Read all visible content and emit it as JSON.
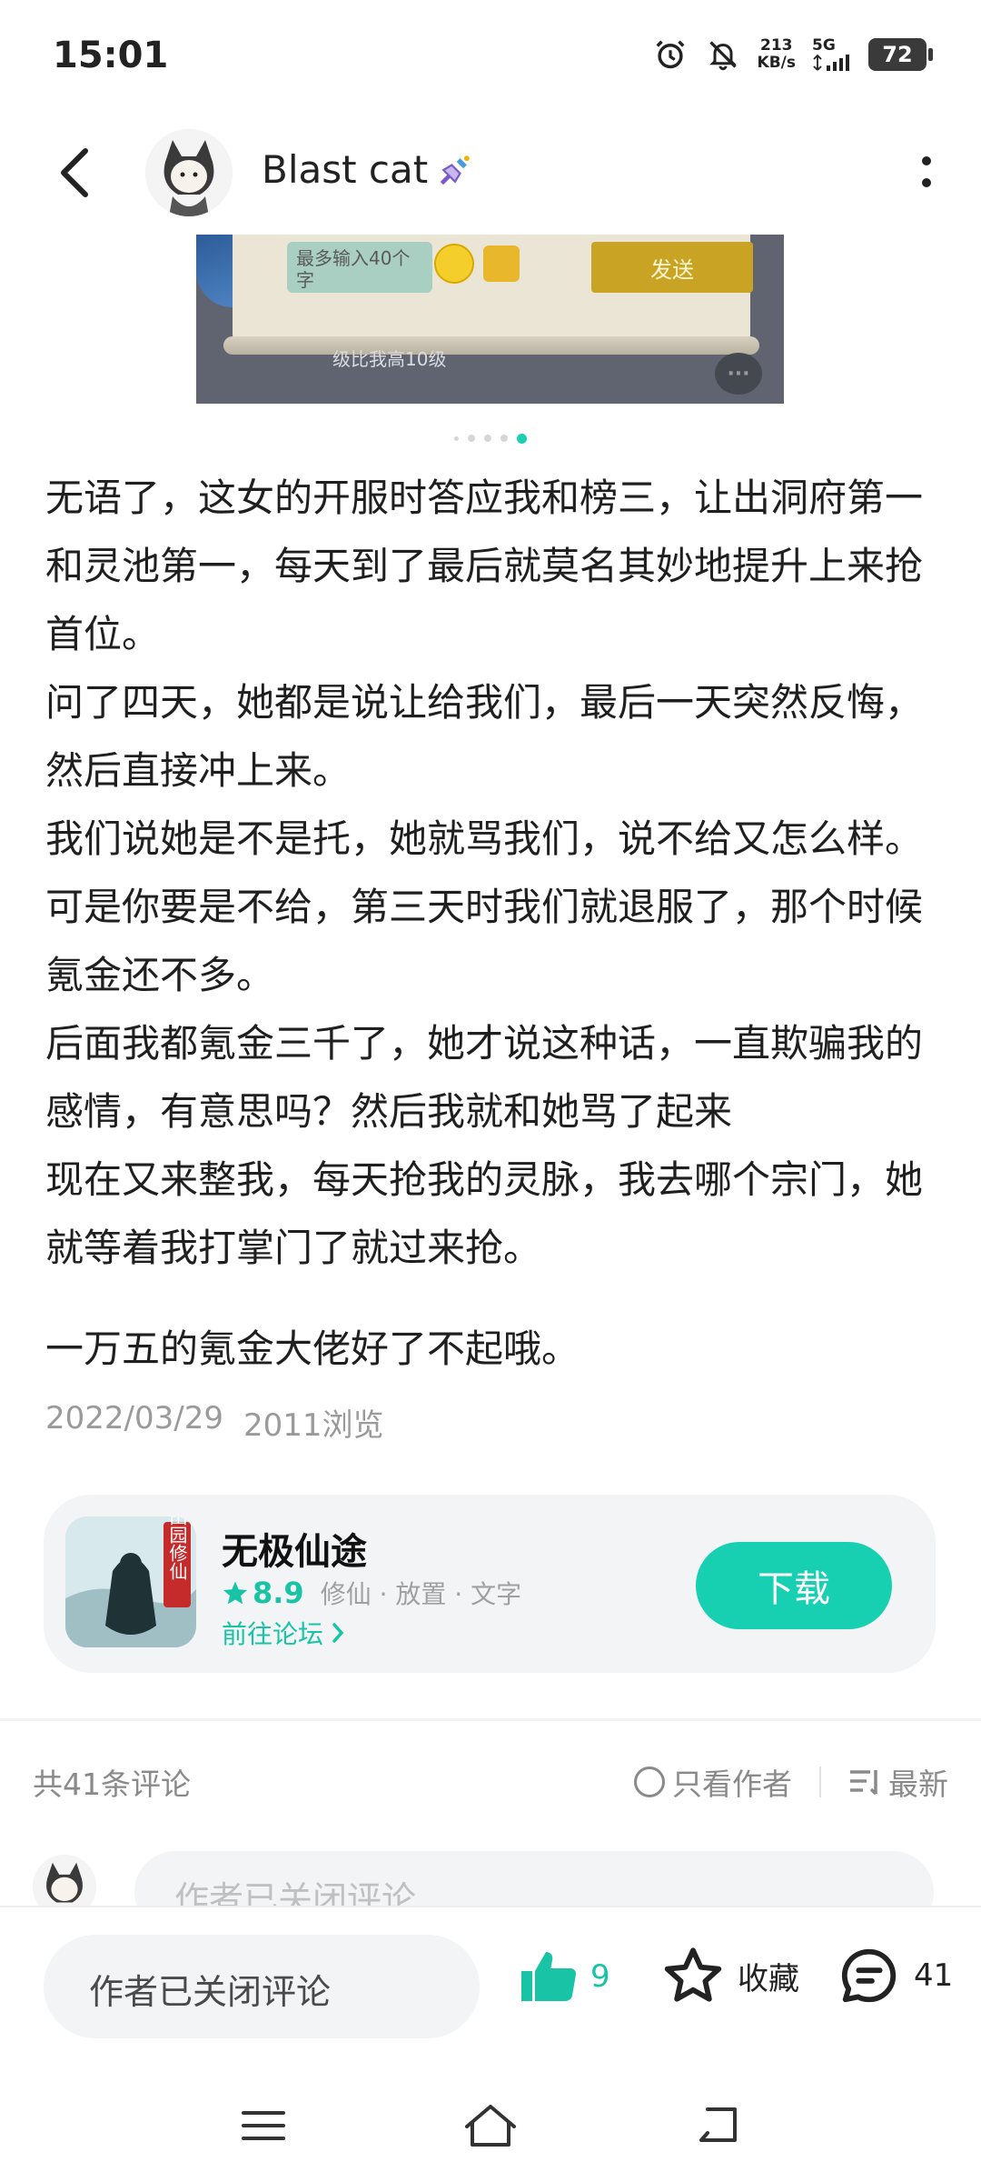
{
  "status_bar": {
    "time": "15:01",
    "speed_value": "213",
    "speed_unit": "KB/s",
    "network": "5G",
    "battery": "72"
  },
  "header": {
    "username": "Blast cat",
    "icons": [
      "back-arrow-icon",
      "avatar",
      "broom-badge-icon",
      "more-vertical-icon"
    ]
  },
  "post_image": {
    "input_placeholder": "最多输入40个字",
    "send_label": "发送",
    "chat_snippet": "级比我高10级",
    "carousel_total": 5,
    "carousel_active": 5
  },
  "post": {
    "paragraphs": [
      "无语了，这女的开服时答应我和榜三，让出洞府第一和灵池第一，每天到了最后就莫名其妙地提升上来抢首位。",
      "问了四天，她都是说让给我们，最后一天突然反悔，然后直接冲上来。",
      "我们说她是不是托，她就骂我们，说不给又怎么样。",
      "可是你要是不给，第三天时我们就退服了，那个时候氪金还不多。",
      "后面我都氪金三千了，她才说这种话，一直欺骗我的感情，有意思吗？然后我就和她骂了起来",
      "现在又来整我，每天抢我的灵脉，我去哪个宗门，她就等着我打掌门了就过来抢。"
    ],
    "closing": "一万五的氪金大佬好了不起哦。",
    "date": "2022/03/29",
    "views": "2011浏览"
  },
  "game_card": {
    "name": "无极仙途",
    "icon_badge": "田园修仙",
    "rating": "8.9",
    "tags": "修仙 · 放置 · 文字",
    "forum_link": "前往论坛",
    "download_label": "下载"
  },
  "comments": {
    "count_label": "共41条评论",
    "only_author": "只看作者",
    "sort_label": "最新",
    "preview_placeholder": "作者已关闭评论"
  },
  "bottom_bar": {
    "input_label": "作者已关闭评论",
    "like_count": "9",
    "favorite_label": "收藏",
    "comment_count": "41"
  },
  "colors": {
    "accent": "#16d0b1",
    "text": "#1f1f1f",
    "muted": "#9a9a9a"
  }
}
